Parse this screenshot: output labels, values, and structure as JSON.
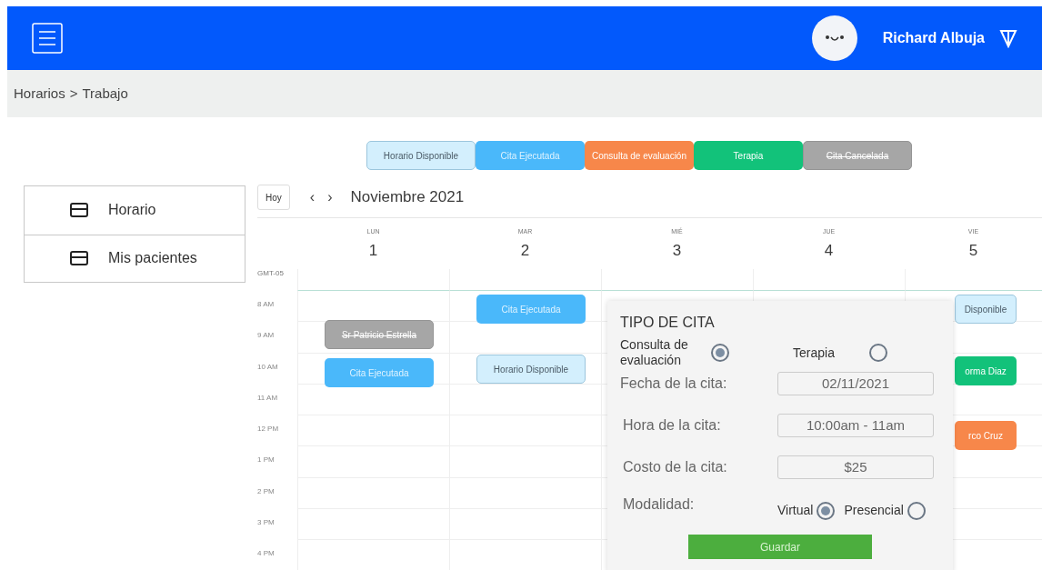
{
  "header": {
    "user_name": "Richard Albuja"
  },
  "breadcrumb": {
    "items": [
      "Horarios",
      "Trabajo"
    ],
    "separator": ">"
  },
  "legend": [
    {
      "label": "Horario Disponible",
      "kind": "available"
    },
    {
      "label": "Cita Ejecutada",
      "kind": "executed"
    },
    {
      "label": "Consulta de evaluación",
      "kind": "evaluation"
    },
    {
      "label": "Terapia",
      "kind": "therapy"
    },
    {
      "label": "Cita Cancelada",
      "kind": "cancelled"
    }
  ],
  "sidebar": {
    "items": [
      {
        "label": "Horario",
        "selected": false
      },
      {
        "label": "Mis pacientes",
        "selected": false
      }
    ]
  },
  "calendar": {
    "today_button": "Hoy",
    "prev": "‹",
    "next": "›",
    "month": "Noviembre 2021",
    "timezone": "GMT-05",
    "days": [
      {
        "weekday": "LUN",
        "date": "1",
        "events": [
          {
            "label": "Sr Patricio Estrella",
            "kind": "cancelled"
          },
          {
            "label": "Cita Ejecutada",
            "kind": "executed"
          }
        ]
      },
      {
        "weekday": "MAR",
        "date": "2",
        "events": [
          {
            "label": "Cita Ejecutada",
            "kind": "executed"
          },
          {
            "label": "Horario Disponible",
            "kind": "available"
          }
        ]
      },
      {
        "weekday": "MIÉ",
        "date": "3"
      },
      {
        "weekday": "JUE",
        "date": "4"
      },
      {
        "weekday": "VIE",
        "date": "5",
        "events": [
          {
            "label": "Disponible",
            "kind": "available"
          },
          {
            "label": "orma Diaz",
            "kind": "therapy"
          },
          {
            "label": "rco Cruz",
            "kind": "evaluation"
          }
        ]
      }
    ],
    "hours": [
      "8 AM",
      "9 AM",
      "10 AM",
      "11 AM",
      "12 PM",
      "1 PM",
      "2 PM",
      "3 PM",
      "4 PM"
    ]
  },
  "appointment_form": {
    "title": "TIPO DE CITA",
    "types": [
      {
        "label": "Consulta de evaluación",
        "selected": true
      },
      {
        "label": "Terapia",
        "selected": false
      }
    ],
    "fields": [
      {
        "label": "Fecha de la cita:",
        "value": "02/11/2021"
      },
      {
        "label": "Hora de la cita:",
        "value": "10:00am - 11am"
      },
      {
        "label": "Costo de la cita:",
        "value": "$25"
      }
    ],
    "modality_label": "Modalidad:",
    "modalities": [
      {
        "label": "Virtual",
        "selected": true
      },
      {
        "label": "Presencial",
        "selected": false
      }
    ],
    "save_button": "Guardar"
  }
}
